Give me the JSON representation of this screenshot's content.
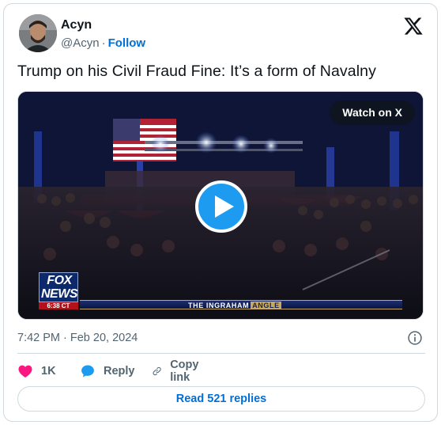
{
  "author": {
    "name": "Acyn",
    "handle": "@Acyn",
    "separator": "·",
    "follow_label": "Follow"
  },
  "icons": {
    "brand": "x-logo-icon",
    "play": "play-icon",
    "info": "info-icon",
    "like": "heart-icon",
    "reply": "reply-bubble-icon",
    "copy": "link-icon"
  },
  "tweet": {
    "text": "Trump on his Civil Fraud Fine: It’s a form of Navalny"
  },
  "media": {
    "watch_label": "Watch on X",
    "network_logo_line1": "FOX",
    "network_logo_line2": "NEWS",
    "network_time": "6:38 CT",
    "chyron_main": "THE INGRAHAM",
    "chyron_tag": "ANGLE"
  },
  "meta": {
    "timestamp": "7:42 PM · Feb 20, 2024"
  },
  "actions": {
    "like_count": "1K",
    "reply_label": "Reply",
    "copy_label": "Copy link"
  },
  "footer": {
    "read_replies_label": "Read 521 replies"
  },
  "colors": {
    "accent": "#1d9bf0",
    "link": "#006fd6",
    "like": "#f91880",
    "secondary_text": "#536471",
    "border": "#cfd9de"
  }
}
